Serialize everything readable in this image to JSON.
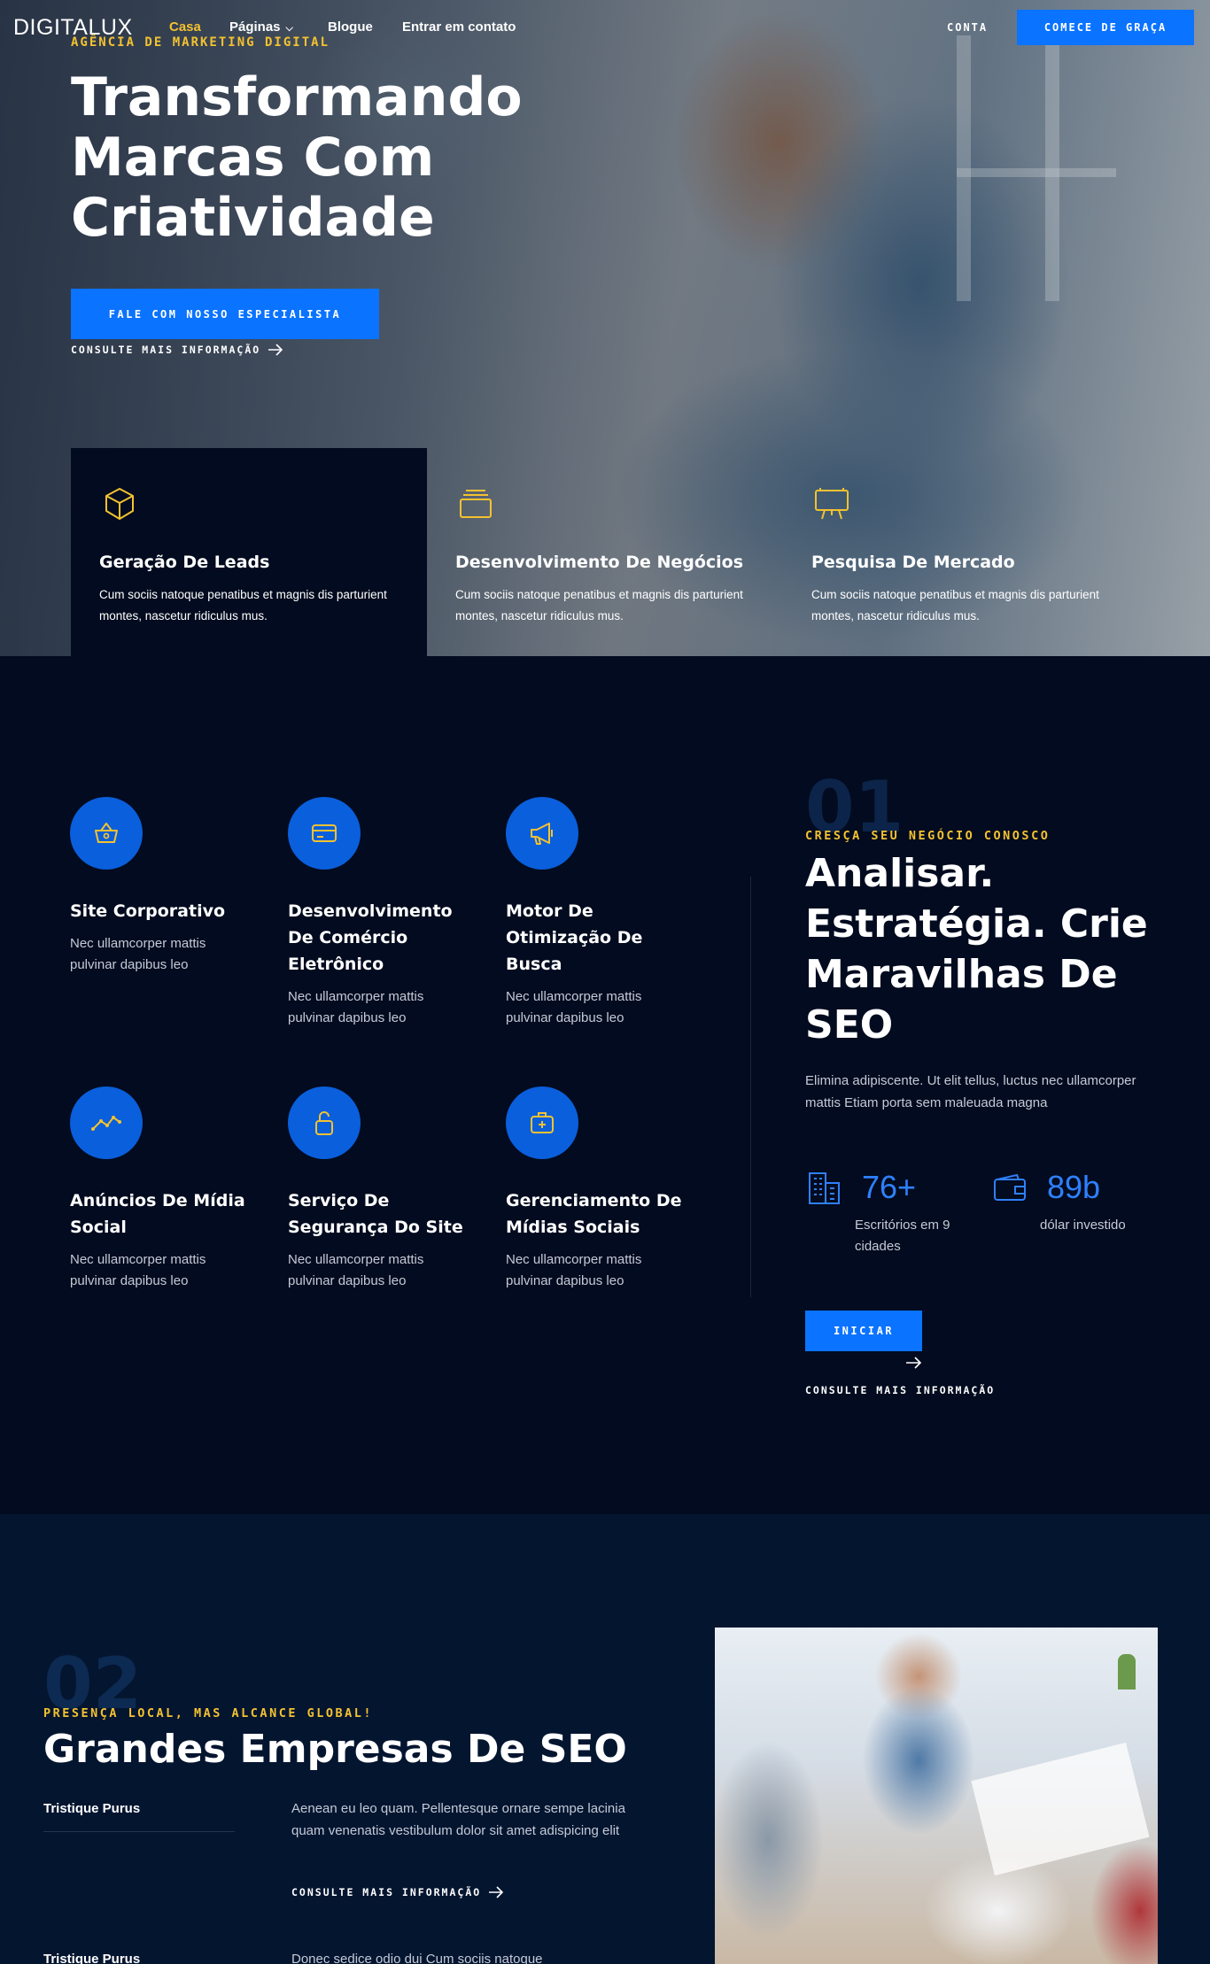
{
  "header": {
    "logo": "DIGITALUX",
    "tagline": "AGÊNCIA DE MARKETING DIGITAL",
    "nav": [
      {
        "label": "Casa",
        "active": true
      },
      {
        "label": "Páginas",
        "has_dropdown": true
      },
      {
        "label": "Blogue"
      },
      {
        "label": "Entrar em contato"
      }
    ],
    "account_label": "CONTA",
    "cta_label": "COMECE DE GRAÇA"
  },
  "hero": {
    "title_lines": [
      "Transformando",
      "Marcas Com",
      "Criatividade"
    ],
    "primary_button": "FALE COM NOSSO ESPECIALISTA",
    "secondary_link": "CONSULTE MAIS INFORMAÇÃO"
  },
  "features": [
    {
      "icon": "box-icon",
      "title": "Geração De Leads",
      "text": "Cum sociis natoque penatibus et magnis dis parturient montes, nascetur ridiculus mus."
    },
    {
      "icon": "stack-icon",
      "title": "Desenvolvimento De Negócios",
      "text": "Cum sociis natoque penatibus et magnis dis parturient montes, nascetur ridiculus mus."
    },
    {
      "icon": "presentation-board-icon",
      "title": "Pesquisa De Mercado",
      "text": "Cum sociis natoque penatibus et magnis dis parturient montes, nascetur ridiculus mus."
    }
  ],
  "services": [
    {
      "icon": "basket-icon",
      "title": "Site Corporativo",
      "text": "Nec ullamcorper mattis pulvinar dapibus leo"
    },
    {
      "icon": "credit-card-icon",
      "title": "Desenvolvimento De Comércio Eletrônico",
      "text": "Nec ullamcorper mattis pulvinar dapibus leo"
    },
    {
      "icon": "megaphone-icon",
      "title": "Motor De Otimização De Busca",
      "text": "Nec ullamcorper mattis pulvinar dapibus leo"
    },
    {
      "icon": "trend-line-icon",
      "title": "Anúncios De Mídia Social",
      "text": "Nec ullamcorper mattis pulvinar dapibus leo"
    },
    {
      "icon": "unlock-icon",
      "title": "Serviço De Segurança Do Site",
      "text": "Nec ullamcorper mattis pulvinar dapibus leo"
    },
    {
      "icon": "medical-kit-icon",
      "title": "Gerenciamento De Mídias Sociais",
      "text": "Nec ullamcorper mattis pulvinar dapibus leo"
    }
  ],
  "grow": {
    "number": "01",
    "eyebrow": "CRESÇA SEU NEGÓCIO CONOSCO",
    "title_lines": [
      "Analisar.",
      "Estratégia. Crie",
      "Maravilhas De",
      "SEO"
    ],
    "text": "Elimina adipiscente. Ut elit tellus, luctus nec ullamcorper mattis Etiam porta sem maleuada magna",
    "stats": [
      {
        "icon": "buildings-icon",
        "value": "76+",
        "label": "Escritórios em 9 cidades"
      },
      {
        "icon": "wallet-icon",
        "value": "89b",
        "label": "dólar investido"
      }
    ],
    "button": "INICIAR",
    "link": "CONSULTE MAIS INFORMAÇÃO"
  },
  "seo": {
    "number": "02",
    "eyebrow": "PRESENÇA LOCAL, MAS ALCANCE GLOBAL!",
    "title": "Grandes Empresas De SEO",
    "items": [
      {
        "label": "Tristique Purus",
        "text": "Aenean eu leo quam. Pellentesque ornare sempe lacinia quam venenatis vestibulum dolor sit amet adispicing elit",
        "link": "CONSULTE MAIS INFORMAÇÃO"
      },
      {
        "label": "Tristique Purus",
        "text": "Donec sedice odio dui Cum sociis natoque"
      }
    ]
  },
  "colors": {
    "accent": "#0a73ff",
    "highlight": "#f4c230",
    "navy": "#020b1f"
  }
}
